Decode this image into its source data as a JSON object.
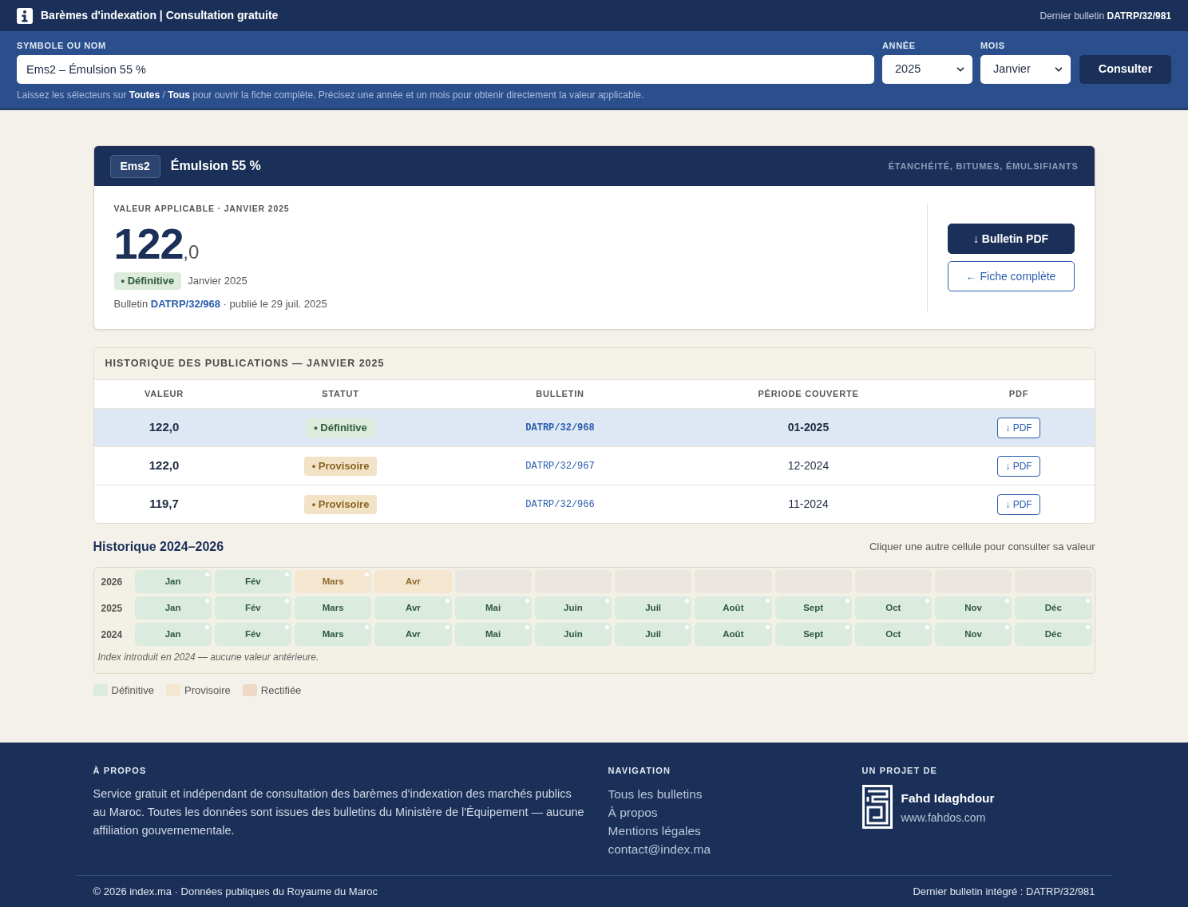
{
  "top_bar": {
    "title": "Barèmes d'indexation | Consultation gratuite",
    "latest": "Dernier bulletin **DATRP/32/981**"
  },
  "search": {
    "symbol_label": "SYMBOLE OU NOM",
    "symbol_value": "Ems2 – Émulsion 55 %",
    "year_label": "ANNÉE",
    "year_value": "2025",
    "month_label": "MOIS",
    "month_value": "Janvier",
    "submit": "Consulter",
    "hint": "Laissez les sélecteurs sur **Toutes** / **Tous** pour ouvrir la fiche complète. Précisez une année et un mois pour obtenir directement la valeur applicable."
  },
  "card": {
    "symbol": "Ems2",
    "name": "Émulsion 55 %",
    "category": "ÉTANCHÉITÉ, BITUMES, ÉMULSIFIANTS",
    "value_label": "VALEUR APPLICABLE · JANVIER 2025",
    "value_integer": "122",
    "value_decimal": ",0",
    "status": {
      "label": "• Définitive",
      "kind": "definitive"
    },
    "period": "Janvier 2025",
    "bulletin_line": {
      "prefix": "Bulletin",
      "link": "DATRP/32/968",
      "suffix": "· publié le 29 juil. 2025"
    },
    "buttons": [
      {
        "label": "↓ Bulletin PDF",
        "kind": "primary"
      },
      {
        "label": "← Fiche complète",
        "kind": "outline"
      }
    ]
  },
  "history_table": {
    "title": "HISTORIQUE DES PUBLICATIONS — JANVIER 2025",
    "columns": [
      "VALEUR",
      "STATUT",
      "BULLETIN",
      "PÉRIODE COUVERTE",
      "PDF"
    ],
    "rows": [
      {
        "value": "122,0",
        "status": {
          "label": "• Définitive",
          "kind": "definitive"
        },
        "bulletin": "DATRP/32/968",
        "period": "01-2025",
        "pdf": "↓ PDF",
        "selected": true
      },
      {
        "value": "122,0",
        "status": {
          "label": "• Provisoire",
          "kind": "provisional"
        },
        "bulletin": "DATRP/32/967",
        "period": "12-2024",
        "pdf": "↓ PDF",
        "selected": false
      },
      {
        "value": "119,7",
        "status": {
          "label": "• Provisoire",
          "kind": "provisional"
        },
        "bulletin": "DATRP/32/966",
        "period": "11-2024",
        "pdf": "↓ PDF",
        "selected": false
      }
    ]
  },
  "calendar": {
    "title": "Historique 2024–2026",
    "hint": "Cliquer une autre cellule pour consulter sa valeur",
    "years": [
      {
        "year": "2026",
        "months": [
          {
            "label": "Jan",
            "kind": "definitive",
            "dot": true
          },
          {
            "label": "Fév",
            "kind": "definitive",
            "dot": true
          },
          {
            "label": "Mars",
            "kind": "provisional",
            "dot": true
          },
          {
            "label": "Avr",
            "kind": "provisional",
            "dot": false
          },
          {
            "kind": "empty"
          },
          {
            "kind": "empty"
          },
          {
            "kind": "empty"
          },
          {
            "kind": "empty"
          },
          {
            "kind": "empty"
          },
          {
            "kind": "empty"
          },
          {
            "kind": "empty"
          },
          {
            "kind": "empty"
          }
        ]
      },
      {
        "year": "2025",
        "months": [
          {
            "label": "Jan",
            "kind": "definitive",
            "dot": true
          },
          {
            "label": "Fév",
            "kind": "definitive",
            "dot": true
          },
          {
            "label": "Mars",
            "kind": "definitive",
            "dot": false
          },
          {
            "label": "Avr",
            "kind": "definitive",
            "dot": true
          },
          {
            "label": "Mai",
            "kind": "definitive",
            "dot": true
          },
          {
            "label": "Juin",
            "kind": "definitive",
            "dot": true
          },
          {
            "label": "Juil",
            "kind": "definitive",
            "dot": true
          },
          {
            "label": "Août",
            "kind": "definitive",
            "dot": true
          },
          {
            "label": "Sept",
            "kind": "definitive",
            "dot": true
          },
          {
            "label": "Oct",
            "kind": "definitive",
            "dot": true
          },
          {
            "label": "Nov",
            "kind": "definitive",
            "dot": true
          },
          {
            "label": "Déc",
            "kind": "definitive",
            "dot": true
          }
        ]
      },
      {
        "year": "2024",
        "months": [
          {
            "label": "Jan",
            "kind": "definitive",
            "dot": true
          },
          {
            "label": "Fév",
            "kind": "definitive",
            "dot": true
          },
          {
            "label": "Mars",
            "kind": "definitive",
            "dot": true
          },
          {
            "label": "Avr",
            "kind": "definitive",
            "dot": true
          },
          {
            "label": "Mai",
            "kind": "definitive",
            "dot": true
          },
          {
            "label": "Juin",
            "kind": "definitive",
            "dot": true
          },
          {
            "label": "Juil",
            "kind": "definitive",
            "dot": true
          },
          {
            "label": "Août",
            "kind": "definitive",
            "dot": true
          },
          {
            "label": "Sept",
            "kind": "definitive",
            "dot": true
          },
          {
            "label": "Oct",
            "kind": "definitive",
            "dot": true
          },
          {
            "label": "Nov",
            "kind": "definitive",
            "dot": true
          },
          {
            "label": "Déc",
            "kind": "definitive",
            "dot": true
          }
        ]
      }
    ],
    "note": "Index introduit en 2024 — aucune valeur antérieure.",
    "legend": [
      {
        "label": "Définitive",
        "kind": "definitive"
      },
      {
        "label": "Provisoire",
        "kind": "provisional"
      },
      {
        "label": "Rectifiée",
        "kind": "rectified"
      }
    ]
  },
  "footer": {
    "about": {
      "heading": "À PROPOS",
      "text": "Service gratuit et indépendant de consultation des barèmes d'indexation des marchés publics au Maroc. Toutes les données sont issues des bulletins du Ministère de l'Équipement — aucune affiliation gouvernementale."
    },
    "navigation": {
      "heading": "NAVIGATION",
      "links": [
        "Tous les bulletins",
        "À propos",
        "Mentions légales",
        "contact@index.ma"
      ]
    },
    "project": {
      "heading": "UN PROJET DE",
      "name": "Fahd Idaghdour",
      "url": "www.fahdos.com"
    },
    "copyright": "© 2026 index.ma · Données publiques du Royaume du Maroc",
    "latest": "Dernier bulletin intégré : DATRP/32/981"
  }
}
